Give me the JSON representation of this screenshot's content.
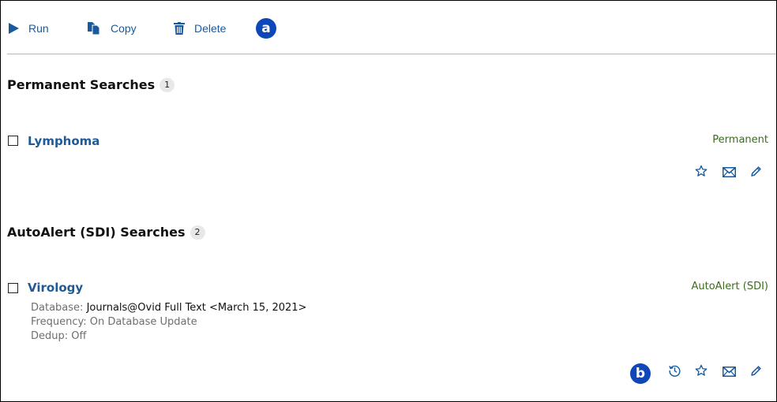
{
  "toolbar": {
    "run_label": "Run",
    "copy_label": "Copy",
    "delete_label": "Delete",
    "callout": "a"
  },
  "permanent": {
    "title": "Permanent Searches",
    "count": "1",
    "items": [
      {
        "name": "Lymphoma",
        "type": "Permanent"
      }
    ]
  },
  "autoalert": {
    "title": "AutoAlert (SDI) Searches",
    "count": "2",
    "items": [
      {
        "name": "Virology",
        "type": "AutoAlert (SDI)",
        "database_label": "Database:",
        "database_value": "Journals@Ovid Full Text <March 15, 2021>",
        "frequency": "Frequency: On Database Update",
        "dedup": "Dedup: Off"
      }
    ],
    "callout": "b"
  },
  "colors": {
    "link": "#1f5a96",
    "accent": "#1047b8",
    "status_green": "#3d6b1f"
  }
}
